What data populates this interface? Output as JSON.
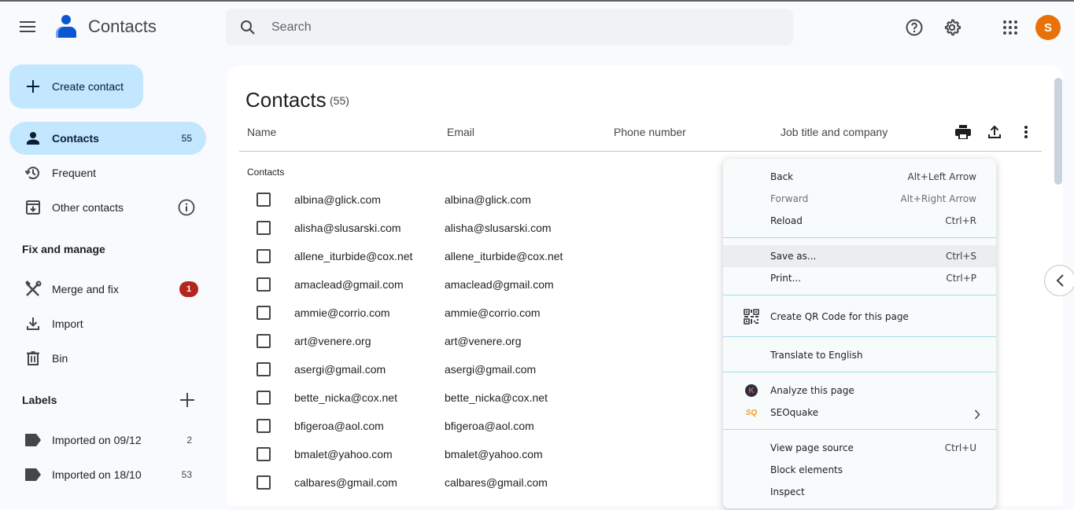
{
  "topbar": {
    "app_title": "Contacts",
    "search_placeholder": "Search",
    "avatar_initial": "S",
    "avatar_color": "#e8710a",
    "icons": [
      "main-menu-icon",
      "contacts-logo-icon",
      "search-icon",
      "help-icon",
      "settings-icon",
      "apps-grid-icon"
    ]
  },
  "sidebar": {
    "create_label": "Create contact",
    "create_bg": "#c2e7ff",
    "active_bg": "#c2e7ff",
    "nav": [
      {
        "label": "Contacts",
        "count": "55",
        "icon": "person-icon",
        "active": true
      },
      {
        "label": "Frequent",
        "icon": "history-icon"
      },
      {
        "label": "Other contacts",
        "icon": "archive-download-icon",
        "trailing_icon": "info-icon"
      }
    ],
    "fix_heading": "Fix and manage",
    "fix_items": [
      {
        "label": "Merge and fix",
        "badge": "1",
        "icon": "merge-fix-icon"
      },
      {
        "label": "Import",
        "icon": "import-icon"
      },
      {
        "label": "Bin",
        "icon": "bin-icon"
      }
    ],
    "badge_color": "#b3261e",
    "labels_heading": "Labels",
    "labels": [
      {
        "label": "Imported on 09/12",
        "count": "2"
      },
      {
        "label": "Imported on 18/10",
        "count": "53"
      }
    ]
  },
  "main": {
    "title": "Contacts",
    "count": "(55)",
    "columns": [
      "Name",
      "Email",
      "Phone number",
      "Job title and company"
    ],
    "group_label": "Contacts",
    "rows": [
      {
        "name": "albina@glick.com",
        "email": "albina@glick.com"
      },
      {
        "name": "alisha@slusarski.com",
        "email": "alisha@slusarski.com"
      },
      {
        "name": "allene_iturbide@cox.net",
        "email": "allene_iturbide@cox.net"
      },
      {
        "name": "amaclead@gmail.com",
        "email": "amaclead@gmail.com"
      },
      {
        "name": "ammie@corrio.com",
        "email": "ammie@corrio.com"
      },
      {
        "name": "art@venere.org",
        "email": "art@venere.org"
      },
      {
        "name": "asergi@gmail.com",
        "email": "asergi@gmail.com"
      },
      {
        "name": "bette_nicka@cox.net",
        "email": "bette_nicka@cox.net"
      },
      {
        "name": "bfigeroa@aol.com",
        "email": "bfigeroa@aol.com"
      },
      {
        "name": "bmalet@yahoo.com",
        "email": "bmalet@yahoo.com"
      },
      {
        "name": "calbares@gmail.com",
        "email": "calbares@gmail.com"
      }
    ]
  },
  "context_menu": {
    "items": [
      {
        "label": "Back",
        "shortcut": "Alt+Left Arrow"
      },
      {
        "label": "Forward",
        "shortcut": "Alt+Right Arrow",
        "disabled": true
      },
      {
        "label": "Reload",
        "shortcut": "Ctrl+R"
      },
      {
        "label": "Save as...",
        "shortcut": "Ctrl+S",
        "highlighted": true
      },
      {
        "label": "Print...",
        "shortcut": "Ctrl+P"
      },
      {
        "label": "Create QR Code for this page",
        "icon": "qr-code-icon"
      },
      {
        "label": "Translate to English"
      },
      {
        "label": "Analyze this page",
        "icon": "k-extension-icon",
        "icon_text": "K"
      },
      {
        "label": "SEOquake",
        "icon": "seoquake-icon",
        "icon_text": "SQ",
        "submenu": true
      },
      {
        "label": "View page source",
        "shortcut": "Ctrl+U"
      },
      {
        "label": "Block elements"
      },
      {
        "label": "Inspect"
      }
    ]
  }
}
